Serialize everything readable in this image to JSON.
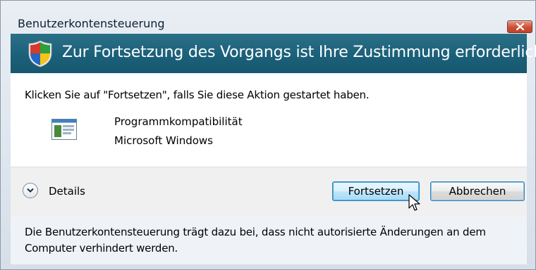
{
  "window": {
    "title": "Benutzerkontensteuerung"
  },
  "header": {
    "text": "Zur Fortsetzung des Vorgangs ist Ihre Zustimmung erforderlich",
    "icon": "shield-icon"
  },
  "content": {
    "instruction": "Klicken Sie auf \"Fortsetzen\", falls Sie diese Aktion gestartet haben.",
    "program_name": "Programmkompatibilität",
    "publisher": "Microsoft Windows",
    "program_icon": "program-window-icon"
  },
  "actions": {
    "details_label": "Details",
    "continue_label": "Fortsetzen",
    "cancel_label": "Abbrechen"
  },
  "footer": {
    "text": "Die Benutzerkontensteuerung trägt dazu bei, dass nicht autorisierte Änderungen an dem Computer verhindert werden."
  },
  "colors": {
    "header_bg": "#1a5f78",
    "close_button": "#cc4f37"
  }
}
